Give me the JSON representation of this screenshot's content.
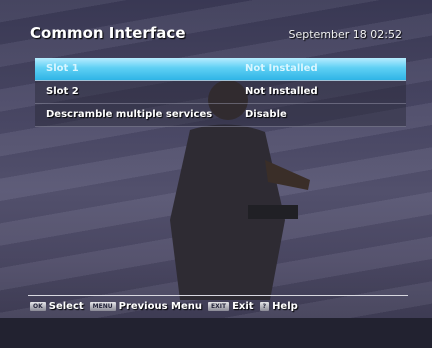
{
  "header": {
    "title": "Common Interface",
    "datetime": "September 18 02:52"
  },
  "menu": {
    "rows": [
      {
        "label": "Slot 1",
        "value": "Not Installed",
        "selected": true
      },
      {
        "label": "Slot 2",
        "value": "Not Installed",
        "selected": false
      },
      {
        "label": "Descramble multiple services",
        "value": "Disable",
        "selected": false
      }
    ]
  },
  "footer": {
    "ok_key": "OK",
    "ok_label": "Select",
    "menu_key": "MENU",
    "menu_label": "Previous Menu",
    "exit_key": "EXIT",
    "exit_label": "Exit",
    "help_key": "?",
    "help_label": "Help"
  },
  "colors": {
    "highlight": "#2fb4e6",
    "background": "#4a4866"
  }
}
